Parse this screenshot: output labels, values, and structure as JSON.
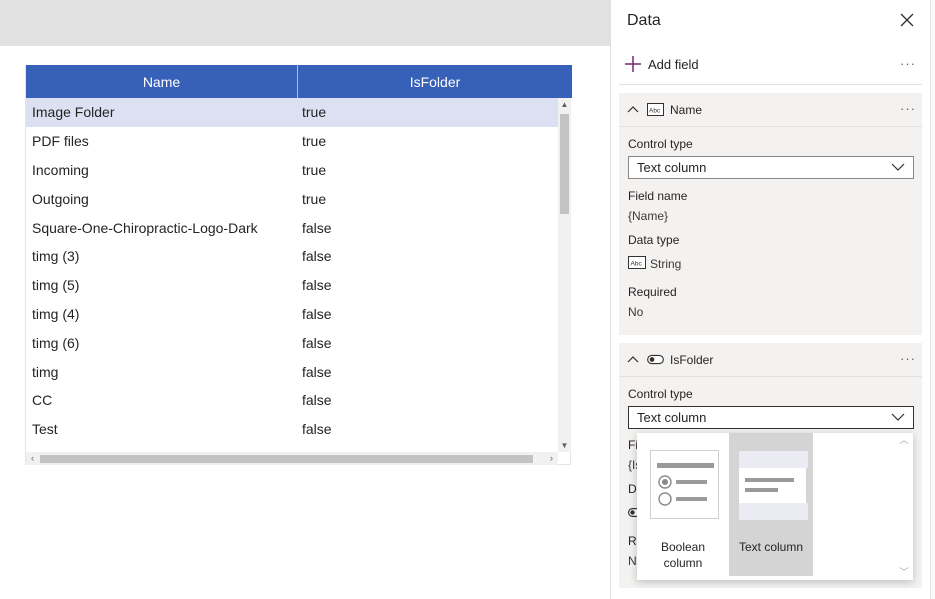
{
  "table": {
    "columns": [
      "Name",
      "IsFolder"
    ],
    "rows": [
      {
        "name": "Image Folder",
        "isfolder": "true"
      },
      {
        "name": "PDF files",
        "isfolder": "true"
      },
      {
        "name": "Incoming",
        "isfolder": "true"
      },
      {
        "name": "Outgoing",
        "isfolder": "true"
      },
      {
        "name": "Square-One-Chiropractic-Logo-Dark",
        "isfolder": "false"
      },
      {
        "name": "timg (3)",
        "isfolder": "false"
      },
      {
        "name": "timg (5)",
        "isfolder": "false"
      },
      {
        "name": "timg (4)",
        "isfolder": "false"
      },
      {
        "name": "timg (6)",
        "isfolder": "false"
      },
      {
        "name": "timg",
        "isfolder": "false"
      },
      {
        "name": "CC",
        "isfolder": "false"
      },
      {
        "name": "Test",
        "isfolder": "false"
      }
    ],
    "selected_row": 0
  },
  "panel": {
    "title": "Data",
    "add_field": "Add field",
    "more": "···",
    "name_field": {
      "header": "Name",
      "control_type_label": "Control type",
      "control_type_value": "Text column",
      "field_name_label": "Field name",
      "field_name_value": "{Name}",
      "data_type_label": "Data type",
      "data_type_value": "String",
      "required_label": "Required",
      "required_value": "No"
    },
    "isfolder_field": {
      "header": "IsFolder",
      "control_type_label": "Control type",
      "control_type_value": "Text column",
      "clipped_field_label": "Fi",
      "clipped_field_value": "{Is",
      "clipped_data_label": "D",
      "clipped_required_label": "R",
      "clipped_required_value": "N"
    }
  },
  "dropdown": {
    "options": [
      {
        "label": "Boolean column",
        "selected": false
      },
      {
        "label": "Text column",
        "selected": true
      }
    ]
  },
  "colors": {
    "header_blue": "#3760b8",
    "selected_row": "#dbe1f3",
    "accent_purple": "#742774"
  }
}
